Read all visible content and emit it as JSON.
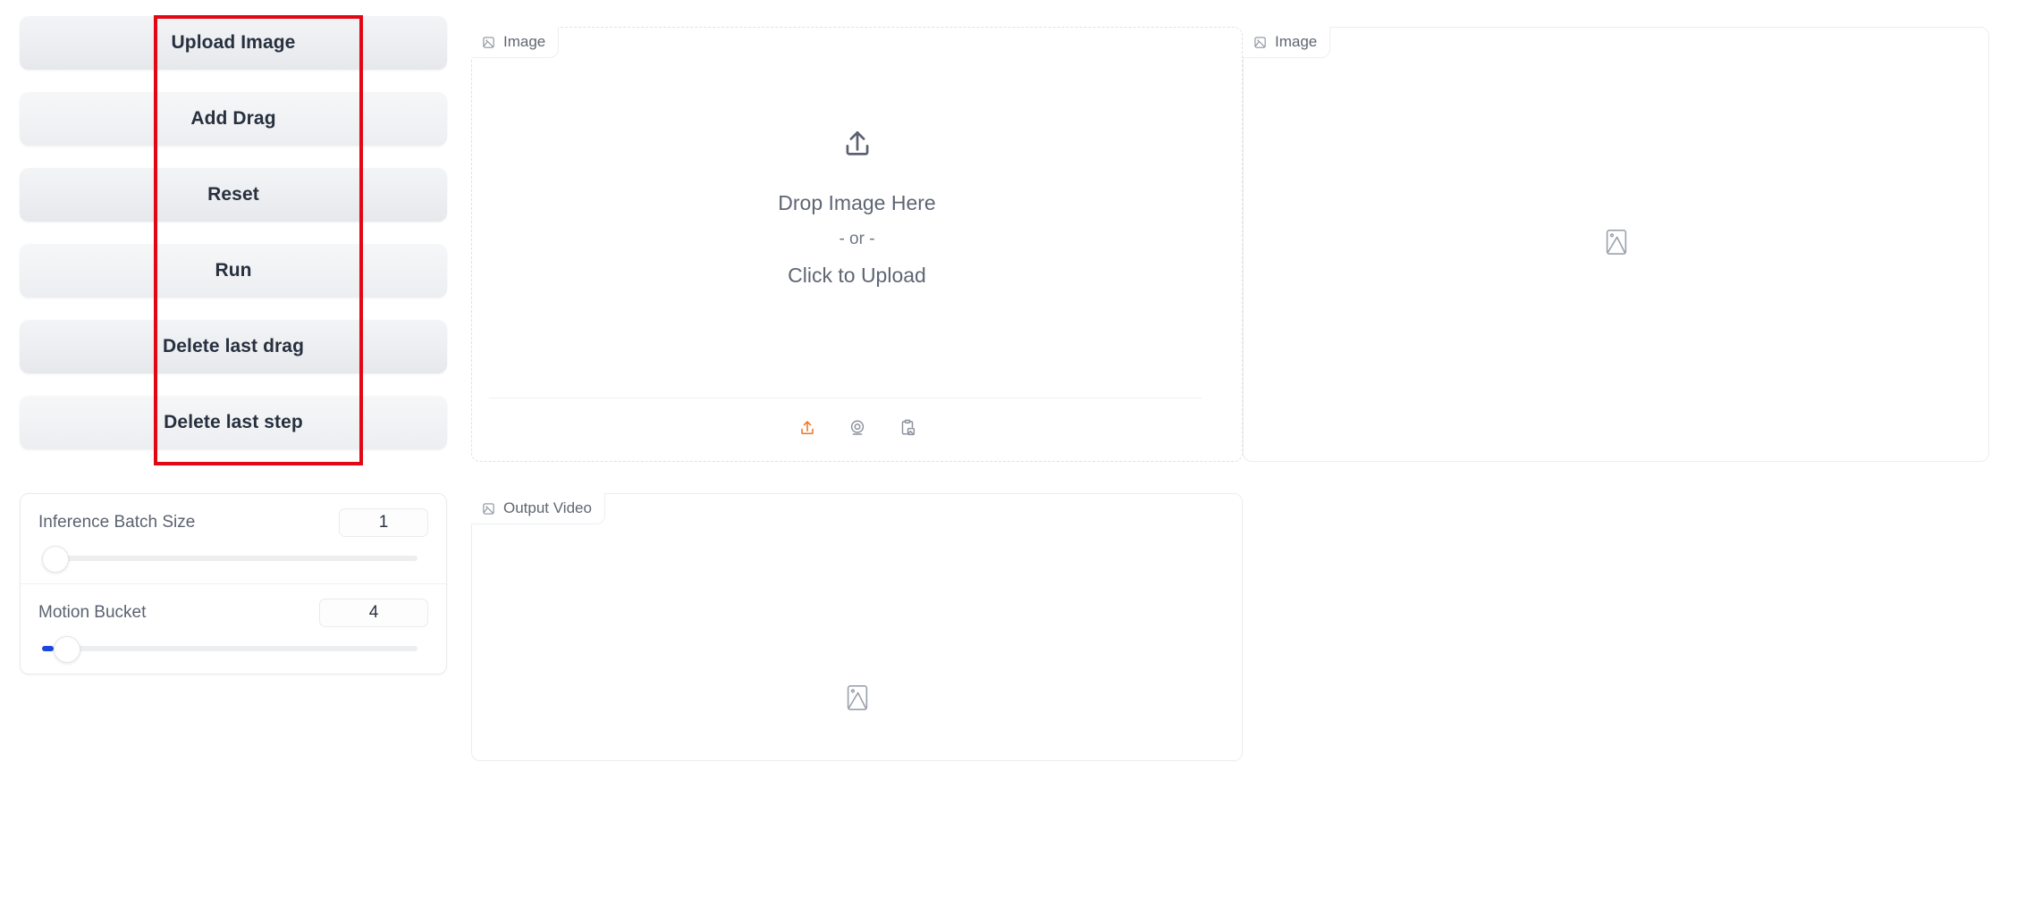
{
  "left_panel": {
    "buttons": [
      {
        "label": "Upload Image",
        "name": "upload-image-button"
      },
      {
        "label": "Add Drag",
        "name": "add-drag-button"
      },
      {
        "label": "Reset",
        "name": "reset-button"
      },
      {
        "label": "Run",
        "name": "run-button"
      },
      {
        "label": "Delete last drag",
        "name": "delete-last-drag-button"
      },
      {
        "label": "Delete last step",
        "name": "delete-last-step-button"
      }
    ],
    "sliders": [
      {
        "label": "Inference Batch Size",
        "value": "1",
        "fill_percent": 0,
        "thumb_percent": 0
      },
      {
        "label": "Motion Bucket",
        "value": "4",
        "fill_percent": 3,
        "thumb_percent": 3
      }
    ]
  },
  "image_input_panel": {
    "tag_label": "Image",
    "tag_icon": "image-icon",
    "upload_icon": "upload-arrow-icon",
    "drop_text": "Drop Image Here",
    "or_text": "- or -",
    "click_text": "Click to Upload",
    "toolbar": [
      {
        "name": "upload-file-icon",
        "label": "Upload file"
      },
      {
        "name": "webcam-icon",
        "label": "Take photo with webcam"
      },
      {
        "name": "clipboard-paste-icon",
        "label": "Paste from clipboard"
      }
    ]
  },
  "image_output_panel": {
    "tag_label": "Image",
    "tag_icon": "image-icon",
    "placeholder_icon": "image-placeholder-icon"
  },
  "output_video_panel": {
    "tag_label": "Output Video",
    "tag_icon": "image-icon",
    "placeholder_icon": "image-placeholder-icon"
  },
  "annotation": {
    "name": "highlight-rectangle",
    "color": "#e30613"
  },
  "colors": {
    "accent_orange": "#ee7622",
    "slider_fill_blue": "#1a47e0",
    "annotation_red": "#e30613",
    "button_text": "#27303f",
    "muted_text": "#5e6573"
  }
}
